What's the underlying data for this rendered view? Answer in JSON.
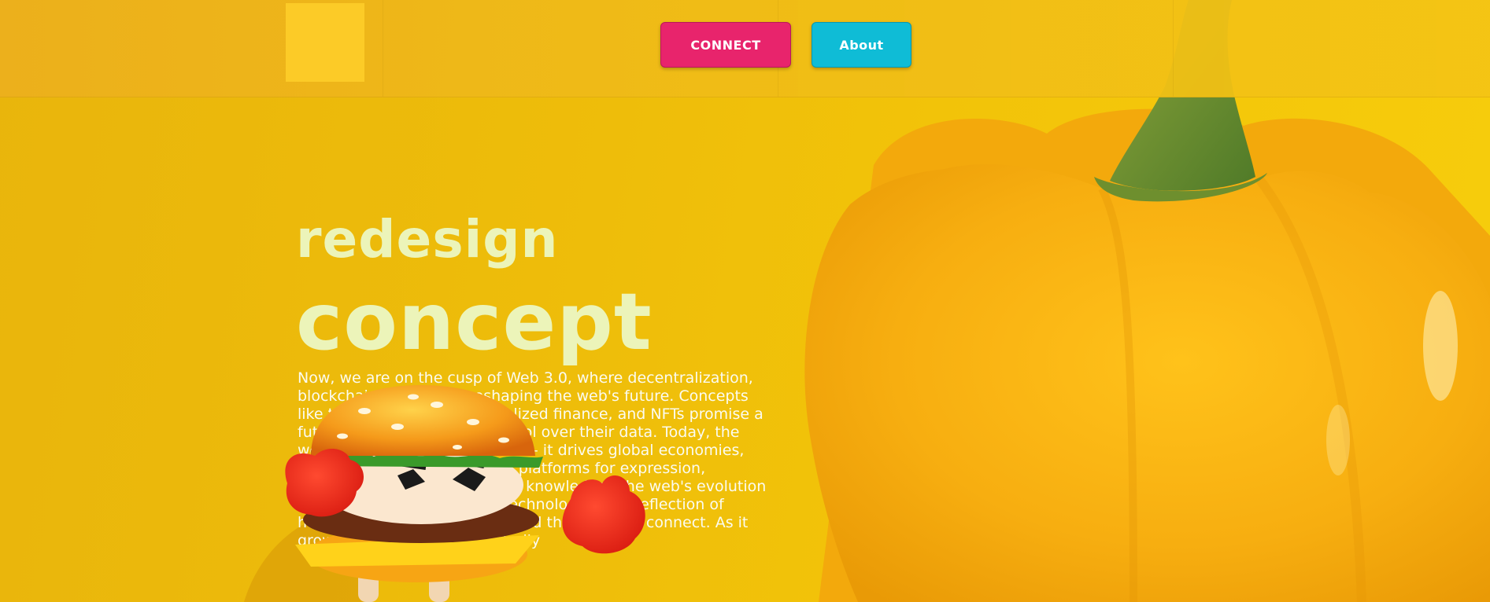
{
  "nav": {
    "connect_label": "CONNECT",
    "about_label": "About"
  },
  "hero": {
    "title_line1": "redesign",
    "title_line2": "concept",
    "body": "Now, we are on the cusp of Web 3.0, where decentralization, blockchain, and AI are reshaping the web's future. Concepts like the metaverse, decentralized finance, and NFTs promise a future where users have control over their data. Today, the web's influence is undeniable — it drives global economies, shapes culture, and provides platforms for expression, connecting us with ethics and knowledge. The web's evolution is a testament: it's not just technology but a reflection of human ingenuity, creativity, and the desire to connect. As it grows, the web will undoubtedly"
  },
  "colors": {
    "background": "#eebd0a",
    "logo_box": "#fccb27",
    "connect_button": "#e8246c",
    "about_button": "#0fbcd6",
    "hero_title": "#ecf4b9"
  },
  "icons": {
    "mascot": "burger-mascot",
    "background_image": "yellow-bell-pepper"
  }
}
